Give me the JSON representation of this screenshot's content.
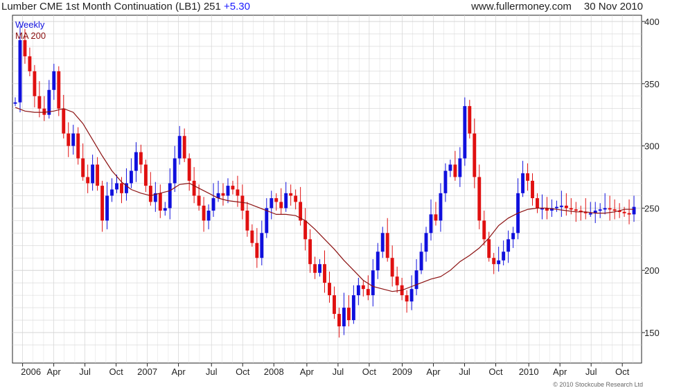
{
  "header": {
    "symbol_text": "Lumber CME 1st Month Continuation (LB1)",
    "last": "251",
    "change": "+5.30",
    "website": "www.fullermoney.com",
    "date": "30 Nov 2010"
  },
  "legend": {
    "weekly": "Weekly",
    "ma": "MA 200"
  },
  "copyright": "© 2010 Stockcube Research Ltd",
  "colors": {
    "up": "#1010dd",
    "down": "#e01010",
    "ma": "#8b1010",
    "grid": "#d4d4d4",
    "axis": "#222222"
  },
  "chart_data": {
    "type": "candlestick",
    "title": "Lumber CME 1st Month Continuation (LB1) 251 +5.30",
    "period": "Weekly",
    "x_range": [
      "2006-01",
      "2010-11"
    ],
    "ylim": [
      130,
      400
    ],
    "y_ticks": [
      150,
      200,
      250,
      300,
      350,
      400
    ],
    "y_axis_side": "right",
    "x_tick_labels": [
      "2006",
      "Apr",
      "Jul",
      "Oct",
      "2007",
      "Apr",
      "Jul",
      "Oct",
      "2008",
      "Apr",
      "Jul",
      "Oct",
      "2009",
      "Apr",
      "Jul",
      "Oct",
      "2010",
      "Apr",
      "Jul",
      "Oct"
    ],
    "grid": true,
    "series": [
      {
        "name": "Weekly",
        "kind": "price",
        "x": [
          0,
          2,
          4,
          6,
          8,
          10,
          12,
          14,
          16,
          18,
          20,
          22,
          24,
          26,
          28,
          30,
          32,
          34,
          36,
          38,
          40,
          42,
          44,
          46,
          48,
          50,
          52,
          54,
          56,
          58,
          60,
          62,
          64,
          66,
          68,
          70,
          72,
          74,
          76,
          78,
          80,
          82,
          84,
          86,
          88,
          90,
          92,
          94,
          96,
          98,
          100,
          102,
          104,
          106,
          108,
          110,
          112,
          114,
          116,
          118,
          120,
          122,
          124,
          126,
          128,
          130,
          132,
          134,
          136,
          138,
          140,
          142,
          144,
          146,
          148,
          150,
          152,
          154,
          156,
          158,
          160,
          162,
          164,
          166,
          168,
          170,
          172,
          174,
          176,
          178,
          180,
          182,
          184,
          186,
          188,
          190,
          192,
          194,
          196,
          198,
          200,
          202,
          204,
          206,
          208,
          210,
          212,
          214,
          216,
          218,
          220,
          222,
          224,
          226,
          228,
          230,
          232,
          234,
          236,
          238,
          240,
          242,
          244,
          246,
          248,
          250,
          252,
          254,
          256
        ],
        "values": [
          335,
          385,
          372,
          360,
          340,
          330,
          325,
          345,
          360,
          330,
          310,
          300,
          310,
          290,
          275,
          270,
          285,
          268,
          240,
          260,
          265,
          270,
          262,
          270,
          280,
          295,
          285,
          268,
          255,
          262,
          248,
          250,
          270,
          290,
          308,
          290,
          272,
          260,
          252,
          240,
          248,
          258,
          262,
          260,
          268,
          265,
          260,
          248,
          232,
          222,
          210,
          230,
          250,
          258,
          255,
          250,
          262,
          260,
          255,
          240,
          225,
          205,
          198,
          205,
          190,
          180,
          165,
          155,
          170,
          160,
          180,
          188,
          185,
          180,
          200,
          215,
          230,
          210,
          195,
          188,
          180,
          175,
          185,
          200,
          215,
          230,
          245,
          240,
          262,
          280,
          285,
          275,
          290,
          332,
          310,
          275,
          240,
          225,
          210,
          205,
          208,
          215,
          225,
          230,
          262,
          278,
          272,
          258,
          250,
          250,
          248,
          250,
          251,
          252,
          250,
          249,
          248,
          247,
          246,
          246,
          248,
          249,
          250,
          249,
          248,
          247,
          246,
          245,
          251
        ]
      },
      {
        "name": "MA 200",
        "kind": "moving_average",
        "x": [
          0,
          4,
          8,
          12,
          16,
          20,
          24,
          28,
          32,
          36,
          40,
          44,
          48,
          52,
          56,
          60,
          64,
          68,
          72,
          76,
          80,
          84,
          88,
          92,
          96,
          100,
          104,
          108,
          112,
          116,
          120,
          124,
          128,
          132,
          136,
          140,
          144,
          148,
          152,
          156,
          160,
          164,
          168,
          172,
          176,
          180,
          184,
          188,
          192,
          196,
          200,
          204,
          208,
          212,
          216,
          220,
          224,
          228,
          232,
          236,
          240,
          244,
          248,
          252,
          256
        ],
        "values": [
          331,
          328,
          327,
          327,
          328,
          330,
          327,
          318,
          305,
          292,
          280,
          271,
          265,
          262,
          260,
          262,
          264,
          269,
          270,
          266,
          262,
          258,
          256,
          255,
          254,
          251,
          248,
          245,
          245,
          244,
          240,
          233,
          225,
          217,
          208,
          200,
          192,
          187,
          185,
          183,
          184,
          187,
          190,
          193,
          195,
          200,
          207,
          212,
          218,
          226,
          236,
          242,
          246,
          249,
          250,
          250,
          249,
          248,
          247,
          247,
          246,
          246,
          247,
          249,
          249
        ]
      }
    ]
  }
}
